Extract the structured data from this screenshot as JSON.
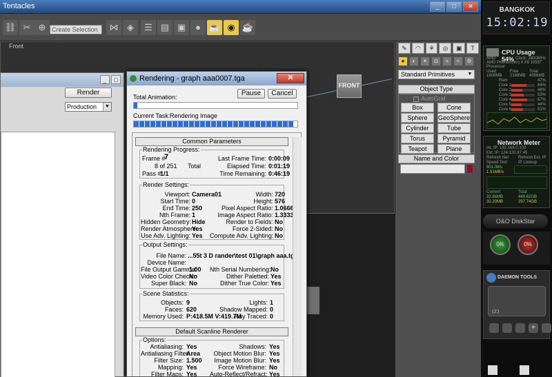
{
  "app": {
    "title": "Tentacles",
    "window_buttons": [
      "_",
      "□",
      "✕"
    ],
    "selection_set_placeholder": "Create Selection Set",
    "viewport_label": "Front",
    "viewcube_label": "FRONT"
  },
  "command_panel": {
    "category": "Standard Primitives",
    "object_type_header": "Object Type",
    "autogrid_label": "AutoGrid",
    "primitives": [
      "Box",
      "Cone",
      "Sphere",
      "GeoSphere",
      "Cylinder",
      "Tube",
      "Torus",
      "Pyramid",
      "Teapot",
      "Plane"
    ],
    "name_color_header": "Name and Color",
    "color": "#8a1030"
  },
  "render_setup": {
    "render_button": "Render",
    "mode": "Production"
  },
  "rendering": {
    "title": "Rendering - graph aaa0007.tga",
    "total_animation_label": "Total Animation:",
    "total_progress": 0.02,
    "pause_label": "Pause",
    "cancel_label": "Cancel",
    "current_task_label": "Current Task:",
    "current_task": "Rendering Image",
    "task_progress": 0.98,
    "common_parameters": "Common Parameters",
    "progress": {
      "group": "Rendering Progress:",
      "frame_label": "Frame #",
      "frame": "7",
      "of_total": "8 of 251",
      "total_label": "Total",
      "pass_label": "Pass #",
      "pass": "1/1",
      "last_frame_time_label": "Last Frame Time:",
      "last_frame_time": "0:00:09",
      "elapsed_label": "Elapsed Time:",
      "elapsed": "0:01:19",
      "remaining_label": "Time Remaining:",
      "remaining": "0:46:19"
    },
    "render_settings": {
      "group": "Render Settings:",
      "left": [
        {
          "label": "Viewport:",
          "value": "Camera01"
        },
        {
          "label": "Start Time:",
          "value": "0"
        },
        {
          "label": "End Time:",
          "value": "250"
        },
        {
          "label": "Nth Frame:",
          "value": "1"
        },
        {
          "label": "Hidden Geometry:",
          "value": "Hide"
        },
        {
          "label": "Render Atmosphere:",
          "value": "Yes"
        },
        {
          "label": "Use Adv. Lighting:",
          "value": "Yes"
        }
      ],
      "right": [
        {
          "label": "Width:",
          "value": "720"
        },
        {
          "label": "Height:",
          "value": "576"
        },
        {
          "label": "Pixel Aspect Ratio:",
          "value": "1.06667"
        },
        {
          "label": "Image Aspect Ratio:",
          "value": "1.33333"
        },
        {
          "label": "Render to Fields:",
          "value": "No"
        },
        {
          "label": "Force 2-Sided:",
          "value": "No"
        },
        {
          "label": "Compute Adv. Lighting:",
          "value": "No"
        }
      ]
    },
    "output_settings": {
      "group": "Output Settings:",
      "file_name_label": "File Name:",
      "file_name": "...55t 3 D rander\\test 01\\graph aaa.tga",
      "device_name_label": "Device Name:",
      "left": [
        {
          "label": "File Output Gamma:",
          "value": "1.00"
        },
        {
          "label": "Video Color Check:",
          "value": "No"
        },
        {
          "label": "Super Black:",
          "value": "No"
        }
      ],
      "right": [
        {
          "label": "Nth Serial Numbering:",
          "value": "No"
        },
        {
          "label": "Dither Paletted:",
          "value": "Yes"
        },
        {
          "label": "Dither True Color:",
          "value": "Yes"
        }
      ]
    },
    "scene_statistics": {
      "group": "Scene Statistics:",
      "left": [
        {
          "label": "Objects:",
          "value": "9"
        },
        {
          "label": "Faces:",
          "value": "620"
        },
        {
          "label": "Memory Used:",
          "value": "P:418.5M V:419.7M"
        }
      ],
      "right": [
        {
          "label": "Lights:",
          "value": "1"
        },
        {
          "label": "Shadow Mapped:",
          "value": "0"
        },
        {
          "label": "Ray Traced:",
          "value": "0"
        }
      ]
    },
    "scanline_header": "Default Scanline Renderer",
    "options": {
      "group": "Options:",
      "left": [
        {
          "label": "Antialiasing:",
          "value": "Yes"
        },
        {
          "label": "Antialiasing Filter:",
          "value": "Area"
        },
        {
          "label": "Filter Size:",
          "value": "1.500"
        },
        {
          "label": "Mapping:",
          "value": "Yes"
        },
        {
          "label": "Filter Maps:",
          "value": "Yes"
        }
      ],
      "right": [
        {
          "label": "Shadows:",
          "value": "Yes"
        },
        {
          "label": "Object Motion Blur:",
          "value": "Yes"
        },
        {
          "label": "Image Motion Blur:",
          "value": "Yes"
        },
        {
          "label": "Force Wireframe:",
          "value": "No"
        },
        {
          "label": "Auto-Reflect/Refract:",
          "value": "Yes"
        }
      ]
    }
  },
  "sidebar": {
    "clock_city": "BANGKOK",
    "clock_time": "15:02:19",
    "cpu_title": "CPU Usage",
    "cpu_percent": "54%",
    "cpu_brand": "AMD",
    "cpu_clock": "Clock: 2800MHz",
    "cpu_model": "AMD Phenom(tm) II X6 1055T Processor",
    "ram_headers": [
      "Used",
      "Free",
      "Total"
    ],
    "ram_values": [
      "1908MB",
      "2188MB",
      "4096MB"
    ],
    "ram_label": "Ram",
    "ram_percent": "47%",
    "cores": [
      {
        "name": "Core 1",
        "pct": "64%",
        "level": 0.64
      },
      {
        "name": "Core 2",
        "pct": "48%",
        "level": 0.48
      },
      {
        "name": "Core 3",
        "pct": "53%",
        "level": 0.53
      },
      {
        "name": "Core 4",
        "pct": "67%",
        "level": 0.67
      },
      {
        "name": "Core 5",
        "pct": "44%",
        "level": 0.44
      },
      {
        "name": "Core 6",
        "pct": "51%",
        "level": 0.51
      }
    ],
    "net_title": "Network Meter",
    "net_int_ip": "Int. IP: 192.168.0.103",
    "net_ext_ip": "Ext. IP: 124.120.87.45",
    "net_refresh": "Refresh Net",
    "net_refresh_ext": "Refresh Ext. IP",
    "net_speed": "Speed Test",
    "net_lookup": "IP Lookup",
    "net_down": "901.08/s",
    "net_up": "1.51MB/s",
    "net_current": "Current",
    "net_total": "Total",
    "net_cur_down": "32.66MB",
    "net_cur_up": "32.20MB",
    "net_tot_down": "449.62GB",
    "net_tot_up": "297.74GB",
    "diskstar": "O&O DiskStar",
    "gauge_left": "0%",
    "gauge_right": "0%",
    "daemon": "DAEMON TOOLS",
    "daemon_drive": "(J:)"
  }
}
